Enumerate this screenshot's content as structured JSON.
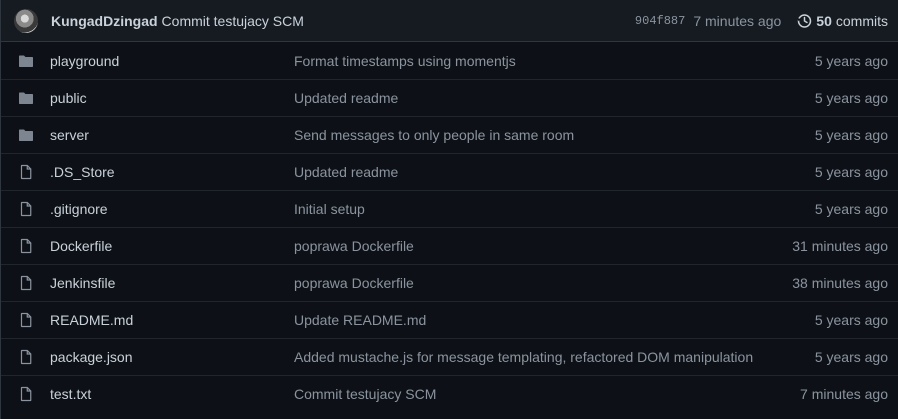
{
  "latest_commit": {
    "author": "KungadDzingad",
    "message": "Commit testujacy SCM",
    "sha": "904f887",
    "time": "7 minutes ago",
    "commit_count": "50",
    "commits_label": "commits"
  },
  "files": [
    {
      "type": "dir",
      "icon": "folder-icon",
      "name": "playground",
      "message": "Format timestamps using momentjs",
      "age": "5 years ago"
    },
    {
      "type": "dir",
      "icon": "folder-icon",
      "name": "public",
      "message": "Updated readme",
      "age": "5 years ago"
    },
    {
      "type": "dir",
      "icon": "folder-icon",
      "name": "server",
      "message": "Send messages to only people in same room",
      "age": "5 years ago"
    },
    {
      "type": "file",
      "icon": "file-icon",
      "name": ".DS_Store",
      "message": "Updated readme",
      "age": "5 years ago"
    },
    {
      "type": "file",
      "icon": "file-icon",
      "name": ".gitignore",
      "message": "Initial setup",
      "age": "5 years ago"
    },
    {
      "type": "file",
      "icon": "file-icon",
      "name": "Dockerfile",
      "message": "poprawa Dockerfile",
      "age": "31 minutes ago"
    },
    {
      "type": "file",
      "icon": "file-icon",
      "name": "Jenkinsfile",
      "message": "poprawa Dockerfile",
      "age": "38 minutes ago"
    },
    {
      "type": "file",
      "icon": "file-icon",
      "name": "README.md",
      "message": "Update README.md",
      "age": "5 years ago"
    },
    {
      "type": "file",
      "icon": "file-icon",
      "name": "package.json",
      "message": "Added mustache.js for message templating, refactored DOM manipulation",
      "age": "5 years ago"
    },
    {
      "type": "file",
      "icon": "file-icon",
      "name": "test.txt",
      "message": "Commit testujacy SCM",
      "age": "7 minutes ago"
    }
  ],
  "colors": {
    "background": "#0d1117",
    "header_background": "#161b22",
    "text": "#c9d1d9",
    "muted": "#8b949e",
    "border": "#21262d",
    "folder_icon": "#7d8590"
  }
}
